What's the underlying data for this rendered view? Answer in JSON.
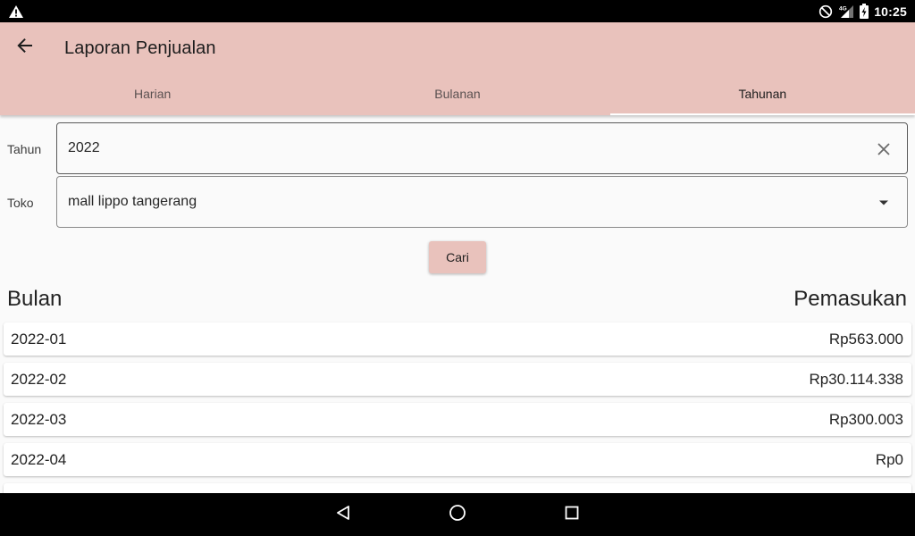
{
  "status_bar": {
    "time": "10:25",
    "network_label": "4G",
    "icons": [
      "alert-icon",
      "do-not-disturb-icon",
      "signal-icon",
      "battery-charging-icon"
    ]
  },
  "app_bar": {
    "title": "Laporan Penjualan",
    "back_icon": "arrow-back-icon",
    "background_color": "#e9c2bc"
  },
  "tabs": [
    {
      "label": "Harian",
      "active": false
    },
    {
      "label": "Bulanan",
      "active": false
    },
    {
      "label": "Tahunan",
      "active": true
    }
  ],
  "form": {
    "year_label": "Tahun",
    "year_value": "2022",
    "year_clear_icon": "clear-icon",
    "store_label": "Toko",
    "store_value": "mall lippo tangerang",
    "store_dropdown_icon": "dropdown-arrow-icon"
  },
  "search_button": {
    "label": "Cari"
  },
  "table": {
    "headers": {
      "month": "Bulan",
      "income": "Pemasukan"
    },
    "rows": [
      {
        "month": "2022-01",
        "income": "Rp563.000"
      },
      {
        "month": "2022-02",
        "income": "Rp30.114.338"
      },
      {
        "month": "2022-03",
        "income": "Rp300.003"
      },
      {
        "month": "2022-04",
        "income": "Rp0"
      }
    ]
  },
  "nav_bar": {
    "buttons": [
      "back-triangle-icon",
      "home-circle-icon",
      "recents-square-icon"
    ]
  }
}
